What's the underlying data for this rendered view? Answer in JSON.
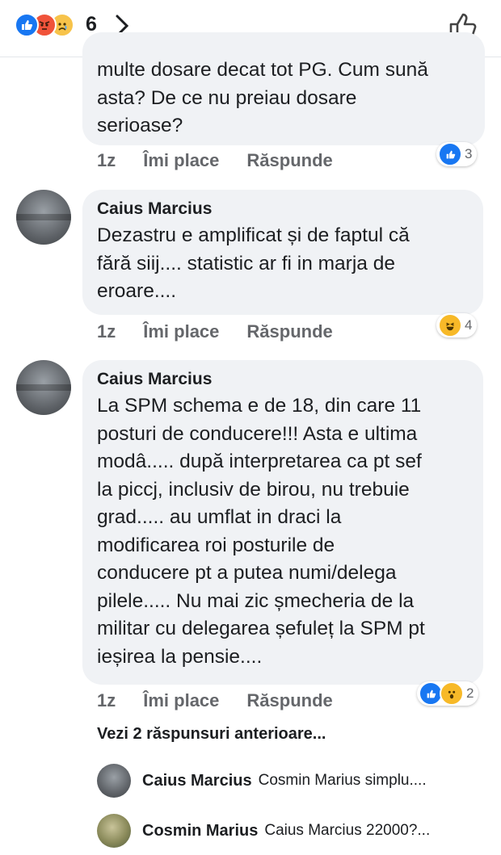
{
  "header": {
    "reaction_count": "6",
    "icons": [
      "like-icon",
      "angry-icon",
      "sad-icon"
    ]
  },
  "comments": [
    {
      "text": "multe dosare decat tot PG. Cum sună\nasta? De ce nu preiau dosare\nserioase?",
      "time": "1z",
      "like": "Îmi place",
      "reply": "Răspunde",
      "reactions": {
        "icons": [
          "like-icon"
        ],
        "count": "3"
      }
    },
    {
      "author": "Caius Marcius",
      "text": "Dezastru e amplificat și de faptul că\nfără siij.... statistic ar fi in marja de\neroare....",
      "time": "1z",
      "like": "Îmi place",
      "reply": "Răspunde",
      "reactions": {
        "icons": [
          "haha-icon"
        ],
        "count": "4"
      }
    },
    {
      "author": "Caius Marcius",
      "text": "La SPM schema e de 18, din care 11\nposturi de conducere!!! Asta e ultima\nmodâ..... după interpretarea ca pt sef\nla piccj, inclusiv de birou, nu trebuie\ngrad..... au umflat in draci la\nmodificarea roi posturile de\nconducere pt a putea numi/delega\npilele..... Nu mai zic șmecheria de la\nmilitar cu delegarea șefuleț la SPM pt\nieșirea la pensie....",
      "time": "1z",
      "like": "Îmi place",
      "reply": "Răspunde",
      "reactions": {
        "icons": [
          "like-icon",
          "wow-icon"
        ],
        "count": "2"
      }
    }
  ],
  "previous_replies_label": "Vezi 2 răspunsuri anterioare...",
  "replies": [
    {
      "author": "Caius Marcius",
      "text": "Cosmin Marius simplu...."
    },
    {
      "author": "Cosmin Marius",
      "text": "Caius Marcius 22000?..."
    }
  ],
  "colors": {
    "like": "#1877f2",
    "angry": "#f0533a",
    "haha": "#f7b928",
    "bubble": "#f0f2f5",
    "meta": "#65676b"
  }
}
